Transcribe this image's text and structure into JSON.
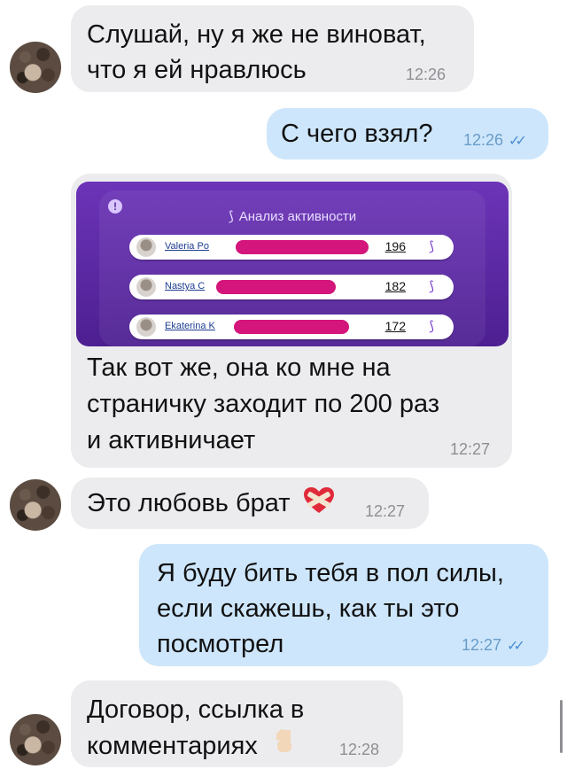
{
  "messages": [
    {
      "lines": [
        "Слушай, ну я же не виноват,",
        "что я ей нравлюсь"
      ],
      "time": "12:26"
    },
    {
      "text": "С чего взял?",
      "time": "12:26"
    },
    {
      "lines": [
        "Так вот же, она ко мне на",
        "страничку заходит по 200 раз",
        "и активничает"
      ],
      "time": "12:27"
    },
    {
      "text": "Это любовь брат",
      "time": "12:27"
    },
    {
      "lines": [
        "Я буду бить тебя в пол силы,",
        "если скажешь, как ты это",
        "посмотрел"
      ],
      "time": "12:27"
    },
    {
      "lines": [
        "Договор, ссылка в",
        "комментариях"
      ],
      "time": "12:28"
    }
  ],
  "screenshot": {
    "title": "Анализ активности",
    "rows": [
      {
        "name": "Valeria Po",
        "count": "196"
      },
      {
        "name": "Nastya C",
        "count": "182"
      },
      {
        "name": "Ekaterina K",
        "count": "172"
      }
    ]
  },
  "icons": {
    "read_check": "double-check-icon",
    "heart": "mended-heart-emoji",
    "point_down": "point-down-emoji",
    "share": "share-network-icon"
  },
  "colors": {
    "incoming_bubble": "#ececef",
    "outgoing_bubble": "#cde6fb",
    "card_purple": "#5a27a3",
    "redaction": "#d4157b"
  }
}
